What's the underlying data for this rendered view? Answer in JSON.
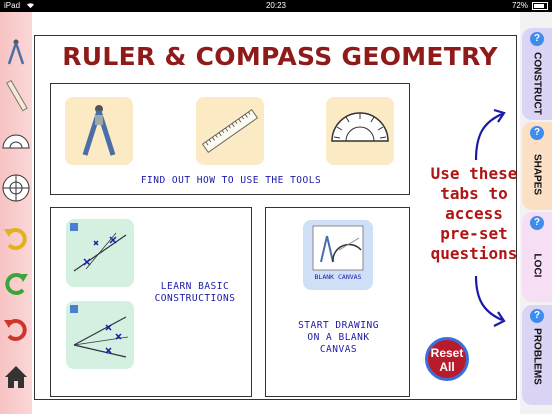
{
  "status_bar": {
    "device": "iPad",
    "time": "20:23",
    "battery": "72%"
  },
  "left_toolbar": {
    "tools": [
      "compass-icon",
      "ruler-icon",
      "protractor-icon",
      "circle-protractor-icon",
      "undo-icon",
      "redo-icon",
      "reset-icon",
      "home-icon"
    ]
  },
  "header": {
    "title": "RULER & COMPASS GEOMETRY"
  },
  "tools_panel": {
    "label": "FIND OUT HOW TO USE THE TOOLS"
  },
  "constructions_panel": {
    "label_line1": "LEARN BASIC",
    "label_line2": "CONSTRUCTIONS"
  },
  "canvas_panel": {
    "thumb_label": "BLANK CANVAS",
    "label_line1": "START DRAWING",
    "label_line2": "ON A BLANK",
    "label_line3": "CANVAS"
  },
  "hint": {
    "line1": "Use these",
    "line2": "tabs to",
    "line3": "access",
    "line4": "pre-set",
    "line5": "questions"
  },
  "reset_button": {
    "line1": "Reset",
    "line2": "All"
  },
  "tabs": [
    {
      "label": "CONSTRUCT",
      "color": "#dcd4f4"
    },
    {
      "label": "SHAPES",
      "color": "#fbe0c6"
    },
    {
      "label": "LOCI",
      "color": "#f6dff4"
    },
    {
      "label": "PROBLEMS",
      "color": "#dcd4f4"
    }
  ],
  "colors": {
    "title": "#8e1a1a",
    "link_text": "#1a1aa8",
    "hint_text": "#b01515",
    "reset_bg": "#b81c2c"
  }
}
